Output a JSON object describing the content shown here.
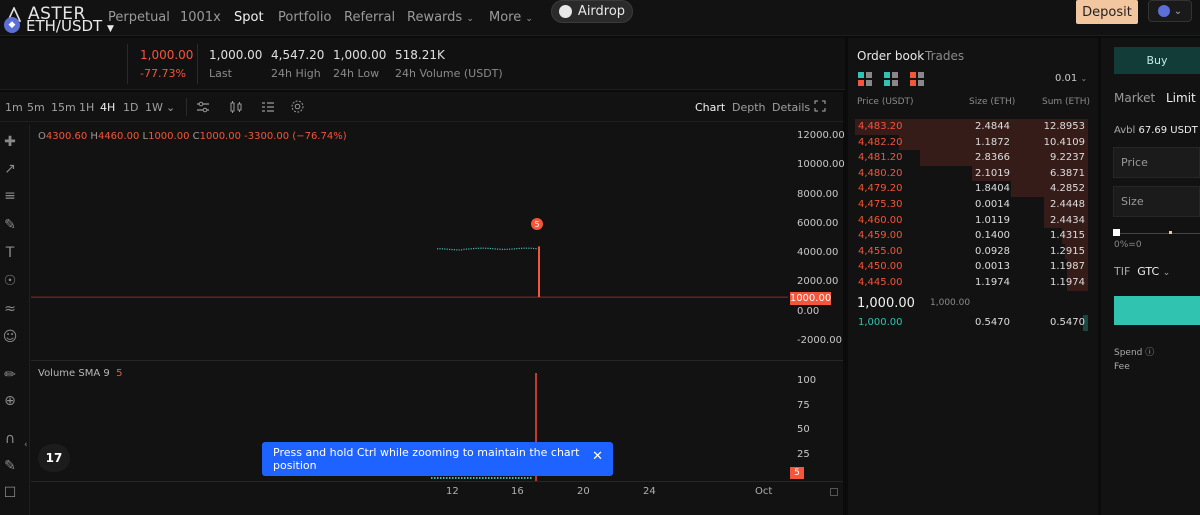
{
  "nav": {
    "brand": "ASTER",
    "items": [
      {
        "label": "Perpetual",
        "active": false
      },
      {
        "label": "1001x",
        "active": false
      },
      {
        "label": "Spot",
        "active": true
      },
      {
        "label": "Portfolio",
        "active": false
      },
      {
        "label": "Referral",
        "active": false
      },
      {
        "label": "Rewards",
        "active": false,
        "dropdown": true
      },
      {
        "label": "More",
        "active": false,
        "dropdown": true
      }
    ],
    "airdrop_label": "Airdrop",
    "deposit_label": "Deposit"
  },
  "ticker": {
    "pair": "ETH/USDT",
    "last_price": "1,000.00",
    "change": "-77.73%",
    "last": {
      "value": "1,000.00",
      "label": "Last"
    },
    "high": {
      "value": "4,547.20",
      "label": "24h High"
    },
    "low": {
      "value": "1,000.00",
      "label": "24h Low"
    },
    "volume": {
      "value": "518.21K",
      "label": "24h Volume (USDT)"
    }
  },
  "chart_toolbar": {
    "intervals": [
      "1m",
      "5m",
      "15m",
      "1H",
      "4H",
      "1D",
      "1W"
    ],
    "active_interval": "4H",
    "views": [
      "Chart",
      "Depth",
      "Details"
    ],
    "active_view": "Chart"
  },
  "ohlc": {
    "o_label": "O",
    "o": "4300.60",
    "h_label": "H",
    "h": "4460.00",
    "l_label": "L",
    "l": "1000.00",
    "c_label": "C",
    "c": "1000.00",
    "change": "-3300.00 (−76.74%)"
  },
  "chart_data": {
    "type": "line",
    "ylim": [
      -2000,
      12000
    ],
    "ytick_labels": [
      "12000.00",
      "10000.00",
      "8000.00",
      "6000.00",
      "4000.00",
      "2000.00",
      "0.00",
      "-2000.00"
    ],
    "current_price_tag": "1000.00",
    "marker_badge": "5",
    "xtick_labels": [
      "12",
      "16",
      "20",
      "24",
      "Oct"
    ],
    "volume_panel": {
      "title": "Volume SMA 9",
      "value": "5",
      "ytick_labels": [
        "100",
        "75",
        "50",
        "25"
      ],
      "current_tag": "5"
    }
  },
  "toast": {
    "message": "Press and hold Ctrl while zooming to maintain the chart position"
  },
  "orderbook": {
    "tabs": [
      "Order book",
      "Trades"
    ],
    "precision": "0.01",
    "headers": {
      "price": "Price (USDT)",
      "size": "Size (ETH)",
      "sum": "Sum (ETH)"
    },
    "asks": [
      {
        "price": "4,483.20",
        "size": "2.4844",
        "sum": "12.8953",
        "depth": 1.0
      },
      {
        "price": "4,482.20",
        "size": "1.1872",
        "sum": "10.4109",
        "depth": 0.81
      },
      {
        "price": "4,481.20",
        "size": "2.8366",
        "sum": "9.2237",
        "depth": 0.72
      },
      {
        "price": "4,480.20",
        "size": "2.1019",
        "sum": "6.3871",
        "depth": 0.5
      },
      {
        "price": "4,479.20",
        "size": "1.8404",
        "sum": "4.2852",
        "depth": 0.33
      },
      {
        "price": "4,475.30",
        "size": "0.0014",
        "sum": "2.4448",
        "depth": 0.19
      },
      {
        "price": "4,460.00",
        "size": "1.0119",
        "sum": "2.4434",
        "depth": 0.19
      },
      {
        "price": "4,459.00",
        "size": "0.1400",
        "sum": "1.4315",
        "depth": 0.11
      },
      {
        "price": "4,455.00",
        "size": "0.0928",
        "sum": "1.2915",
        "depth": 0.1
      },
      {
        "price": "4,450.00",
        "size": "0.0013",
        "sum": "1.1987",
        "depth": 0.09
      },
      {
        "price": "4,445.00",
        "size": "1.1974",
        "sum": "1.1974",
        "depth": 0.09
      }
    ],
    "mid_price": "1,000.00",
    "mid_sub": "1,000.00",
    "bids": [
      {
        "price": "1,000.00",
        "size": "0.5470",
        "sum": "0.5470"
      }
    ]
  },
  "trade": {
    "buy_label": "Buy",
    "order_types": [
      "Market",
      "Limit"
    ],
    "active_order_type": "Limit",
    "avbl_label": "Avbl",
    "avbl_value": "67.69 USDT",
    "price_placeholder": "Price",
    "size_placeholder": "Size",
    "slider_label": "0%=0",
    "tif_label": "TIF",
    "tif_value": "GTC",
    "spend_label": "Spend",
    "fee_label": "Fee"
  },
  "colors": {
    "ask": "#f4553b",
    "bid": "#2fc3b0",
    "deposit": "#f2c7a0",
    "toast": "#1e62ff"
  }
}
